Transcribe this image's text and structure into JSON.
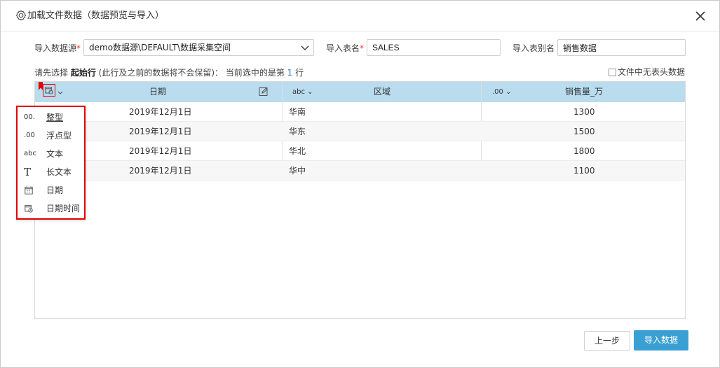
{
  "dialog": {
    "title": "加载文件数据（数据预览与导入）"
  },
  "form": {
    "datasource_label": "导入数据源",
    "datasource_value": "demo数据源\\DEFAULT\\数据采集空间",
    "tablename_label": "导入表名",
    "tablename_value": "SALES",
    "alias_label": "导入表别名",
    "alias_value": "销售数据",
    "required_mark": "*"
  },
  "hint": {
    "prefix": "请先选择 ",
    "bold": "起始行",
    "middle": " (此行及之前的数据将不会保留)： 当前选中的是第 ",
    "row_number": "1",
    "suffix": " 行"
  },
  "no_header": {
    "label": "文件中无表头数据",
    "checked": false
  },
  "table": {
    "columns": [
      {
        "name": "日期",
        "type_tag": ""
      },
      {
        "name": "区域",
        "type_tag": "abc"
      },
      {
        "name": "销售量_万",
        "type_tag": ".00"
      }
    ],
    "rows": [
      [
        "2019年12月1日",
        "华南",
        "1300"
      ],
      [
        "2019年12月1日",
        "华东",
        "1500"
      ],
      [
        "2019年12月1日",
        "华北",
        "1800"
      ],
      [
        "2019年12月1日",
        "华中",
        "1100"
      ]
    ]
  },
  "type_menu": {
    "items": [
      {
        "icon": "00.",
        "label": "整型"
      },
      {
        "icon": ".00",
        "label": "浮点型"
      },
      {
        "icon": "abc",
        "label": "文本"
      },
      {
        "icon": "T",
        "label": "长文本"
      },
      {
        "icon": "calendar",
        "label": "日期"
      },
      {
        "icon": "calendar-clock",
        "label": "日期时间"
      }
    ]
  },
  "footer": {
    "prev_label": "上一步",
    "import_label": "导入数据"
  },
  "colors": {
    "header_bg": "#b9dcef",
    "primary": "#3aa0d3",
    "highlight": "#e00000"
  }
}
